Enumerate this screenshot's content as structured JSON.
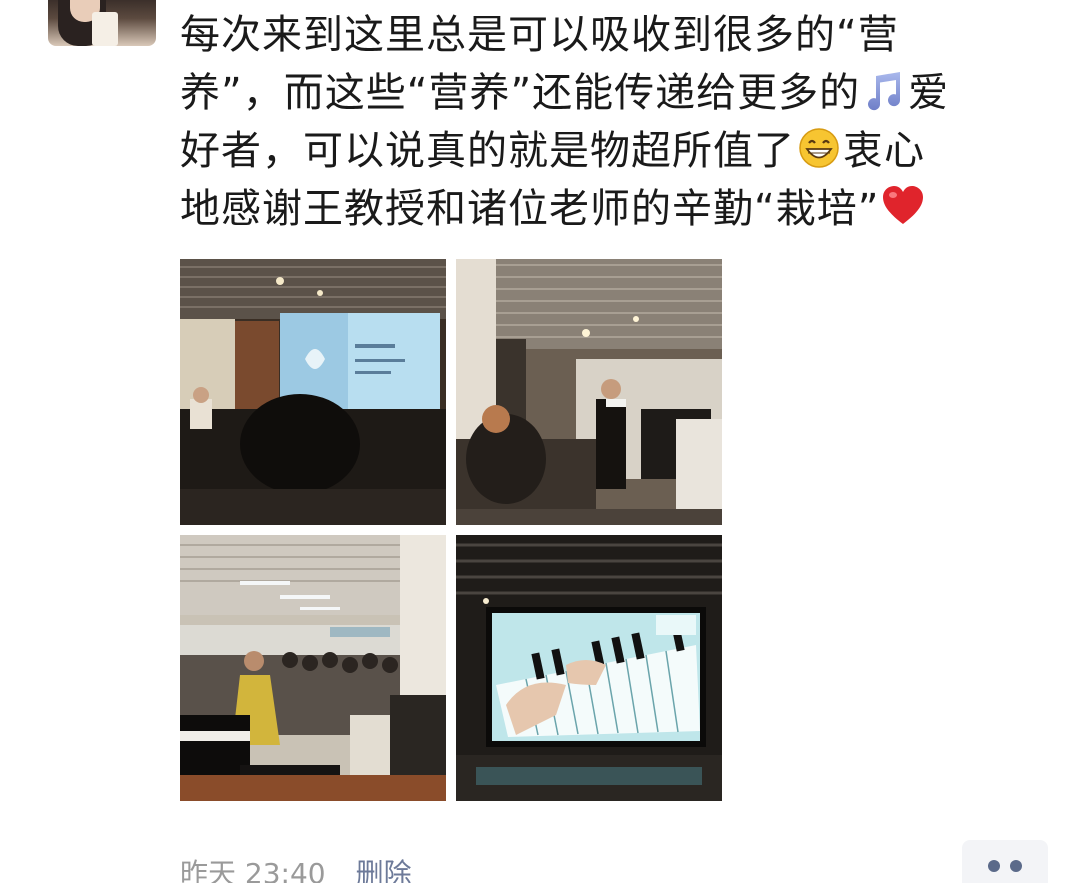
{
  "post": {
    "line1": "每次来到这里总是可以吸收到很多的“营",
    "line2_a": "养”，而这些“营养”还能传递给更多的",
    "line2_b": "爱",
    "line3_a": "好者，可以说真的就是物超所值了",
    "line3_b": "衷心",
    "line4": "地感谢王教授和诸位老师的辛勤“栽培”",
    "emoji_icons": [
      "music-note-icon",
      "grinning-face-icon",
      "red-heart-icon"
    ]
  },
  "footer": {
    "time": "昨天 23:40",
    "delete_label": "删除"
  },
  "colors": {
    "text": "#1a1a1a",
    "meta": "#9a9a9a",
    "link": "#6d7a99",
    "more_dots": "#5b6a8a"
  }
}
